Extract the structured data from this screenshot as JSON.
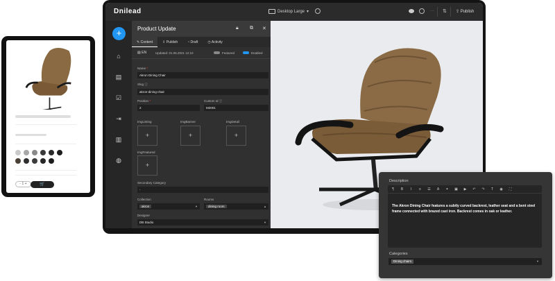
{
  "topbar": {
    "logo": "Dnilead",
    "device": "Desktop Large",
    "publish": "Publish"
  },
  "panel": {
    "title": "Product Update",
    "tabs": [
      "Content",
      "Publish",
      "Draft",
      "Activity"
    ],
    "lang": "EN",
    "updated": "Updated: 01.05.2021 12:10",
    "featured_label": "Featured",
    "enabled_label": "Enabled",
    "fields": {
      "name_label": "Name",
      "name_value": "Akron Dining Chair",
      "slug_label": "Slug",
      "slug_value": "akron-dining-chair",
      "position_label": "Position",
      "position_value": "2",
      "custom_id_label": "Custom Id",
      "custom_id_value": "M2001",
      "img_listing": "ImgListing",
      "img_banner": "ImgBanner",
      "img_detail": "ImgDetail",
      "img_featured": "ImgFeatured",
      "plus": "+",
      "secondary_category_label": "Secondary Category",
      "secondary_category_value": "-",
      "collection_label": "Collection",
      "collection_value": "akron",
      "rooms_label": "Rooms",
      "rooms_value": "dining room",
      "designer_label": "Designer",
      "designer_value": "DB Studio"
    }
  },
  "description": {
    "label": "Description",
    "text": "The Akron Dining Chair features a subtly curved backrest, leather seat and a bent steel frame connected with brazed cast iron. Backrest comes in oak or leather.",
    "categories_label": "Categories",
    "category_value": "Dining chairs",
    "toolbar": [
      "¶",
      "B",
      "I",
      "≡",
      "☰",
      "A",
      "⚭",
      "▣",
      "▶",
      "↶",
      "↷",
      "T",
      "◉",
      "⛶"
    ]
  },
  "tablet": {
    "stepper": "- 1 +"
  },
  "colors": {
    "accent": "#2196f3",
    "swatches": [
      "#c9c9c9",
      "#a8a8a8",
      "#8a8a8a",
      "#3a3a3a",
      "#2a2a2a",
      "#1e1e1e",
      "#4a3f35",
      "#2e2e2e",
      "#3c3c3c",
      "#262626",
      "#1c1c1c"
    ]
  }
}
